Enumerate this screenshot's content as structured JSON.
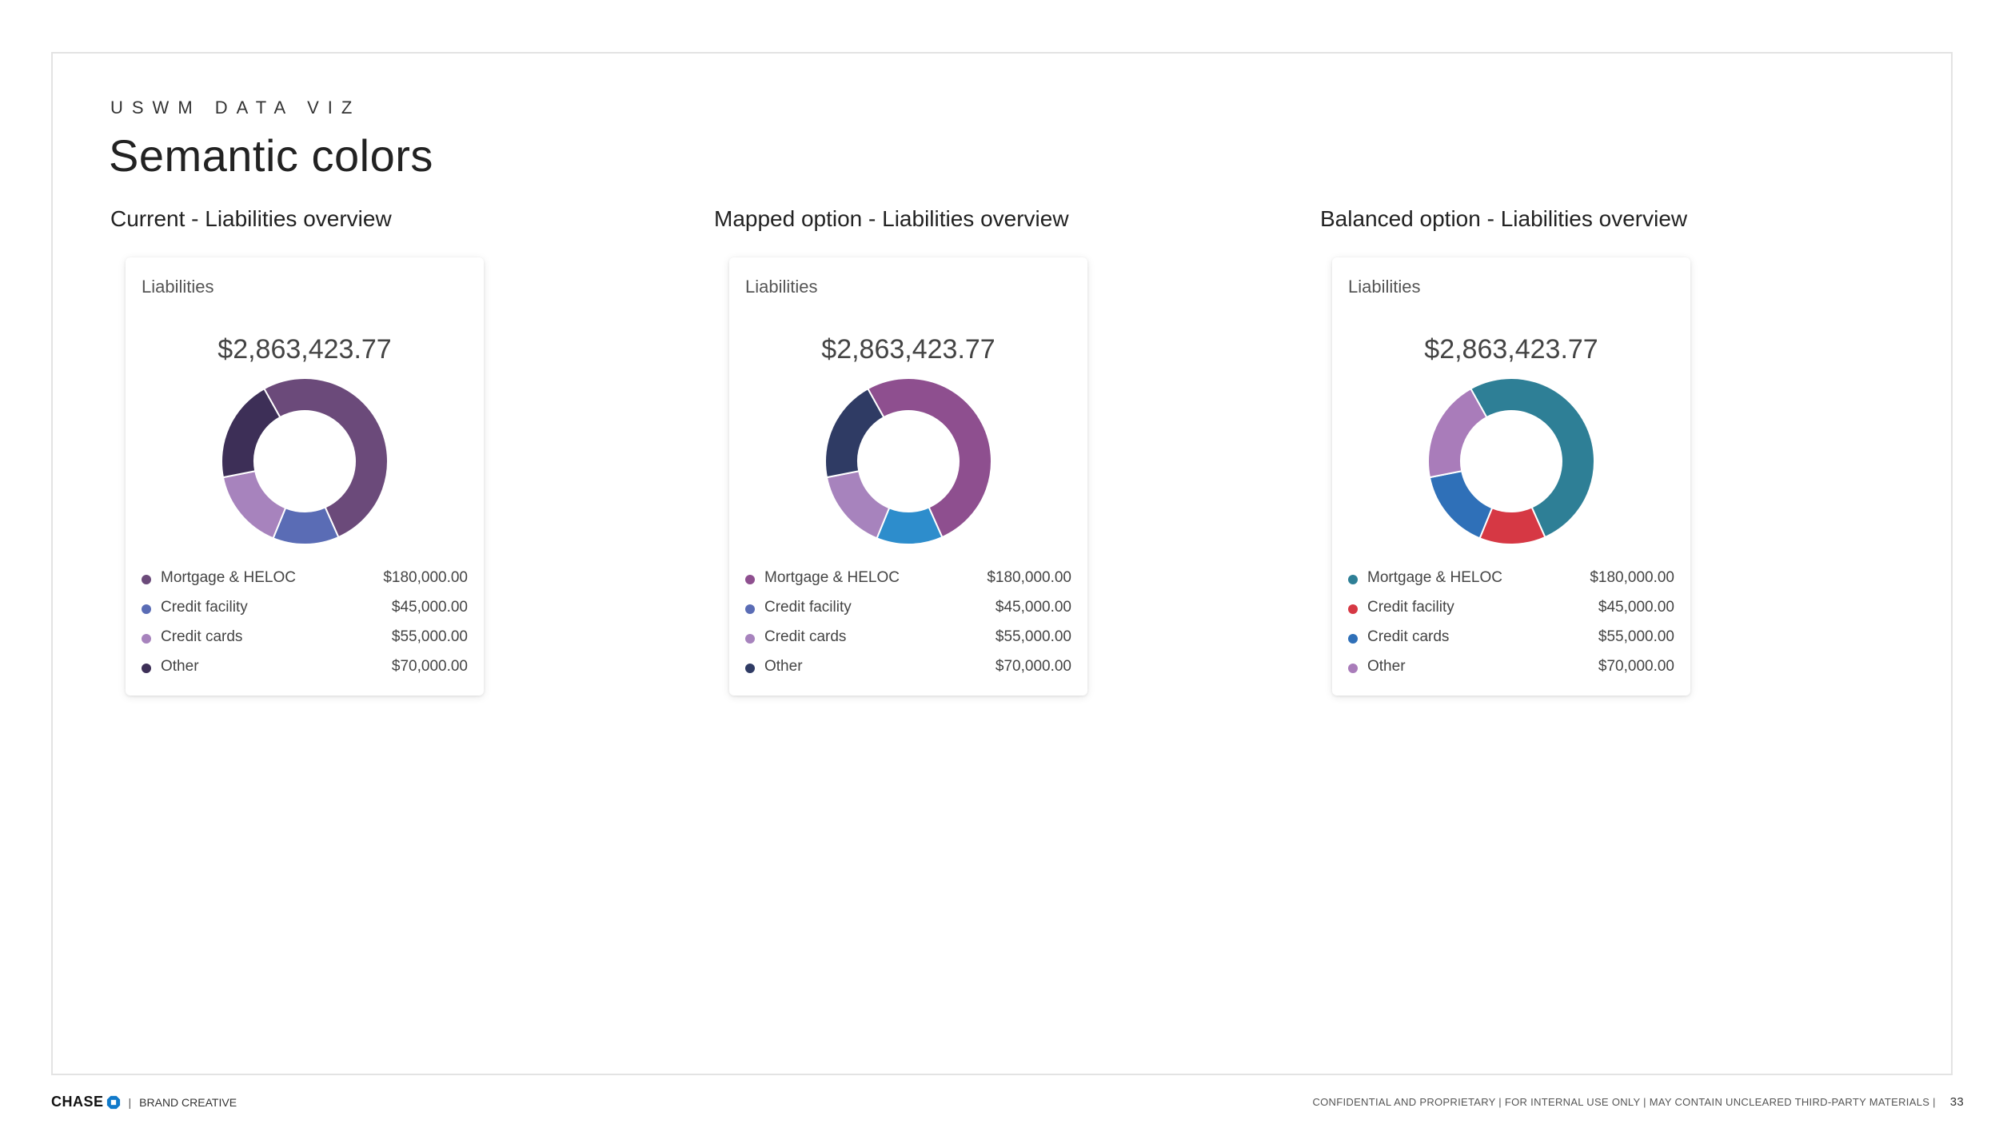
{
  "header": {
    "eyebrow": "USWM DATA VIZ",
    "title": "Semantic colors"
  },
  "panels": [
    {
      "heading": "Current - Liabilities overview",
      "card_title": "Liabilities",
      "total": "$2,863,423.77",
      "legend": [
        {
          "label": "Mortgage & HELOC",
          "value": "$180,000.00",
          "color": "#6b4a7a"
        },
        {
          "label": "Credit facility",
          "value": "$45,000.00",
          "color": "#5a6cb5"
        },
        {
          "label": "Credit cards",
          "value": "$55,000.00",
          "color": "#a783bd"
        },
        {
          "label": "Other",
          "value": "$70,000.00",
          "color": "#3d2f57"
        }
      ]
    },
    {
      "heading": "Mapped option - Liabilities overview",
      "card_title": "Liabilities",
      "total": "$2,863,423.77",
      "legend": [
        {
          "label": "Mortgage & HELOC",
          "value": "$180,000.00",
          "color": "#8e4f8f"
        },
        {
          "label": "Credit facility",
          "value": "$45,000.00",
          "color": "#5a6cb5"
        },
        {
          "label": "Credit cards",
          "value": "$55,000.00",
          "color": "#a783bd"
        },
        {
          "label": "Other",
          "value": "$70,000.00",
          "color": "#2f3b64"
        }
      ]
    },
    {
      "heading": "Balanced option - Liabilities overview",
      "card_title": "Liabilities",
      "total": "$2,863,423.77",
      "legend": [
        {
          "label": "Mortgage & HELOC",
          "value": "$180,000.00",
          "color": "#2e7f96"
        },
        {
          "label": "Credit facility",
          "value": "$45,000.00",
          "color": "#d63844"
        },
        {
          "label": "Credit cards",
          "value": "$55,000.00",
          "color": "#2f70b8"
        },
        {
          "label": "Other",
          "value": "$70,000.00",
          "color": "#a97cba"
        }
      ]
    }
  ],
  "chart_data": [
    {
      "type": "pie",
      "donut": true,
      "categories": [
        "Mortgage & HELOC",
        "Credit facility",
        "Credit cards",
        "Other"
      ],
      "values": [
        180000,
        45000,
        55000,
        70000
      ],
      "colors": [
        "#6b4a7a",
        "#5a6cb5",
        "#a783bd",
        "#3d2f57"
      ]
    },
    {
      "type": "pie",
      "donut": true,
      "categories": [
        "Mortgage & HELOC",
        "Credit facility",
        "Credit cards",
        "Other"
      ],
      "values": [
        180000,
        45000,
        55000,
        70000
      ],
      "colors": [
        "#8e4f8f",
        "#2d8dcc",
        "#a783bd",
        "#2f3b64"
      ]
    },
    {
      "type": "pie",
      "donut": true,
      "categories": [
        "Mortgage & HELOC",
        "Credit facility",
        "Credit cards",
        "Other"
      ],
      "values": [
        180000,
        45000,
        55000,
        70000
      ],
      "colors": [
        "#2e7f96",
        "#d63844",
        "#2f70b8",
        "#a97cba"
      ]
    }
  ],
  "footer": {
    "brand": "CHASE",
    "separator": "|",
    "department": "BRAND CREATIVE",
    "disclaimer": "CONFIDENTIAL AND PROPRIETARY | FOR INTERNAL USE ONLY | MAY CONTAIN UNCLEARED THIRD-PARTY MATERIALS |",
    "page_number": "33"
  }
}
